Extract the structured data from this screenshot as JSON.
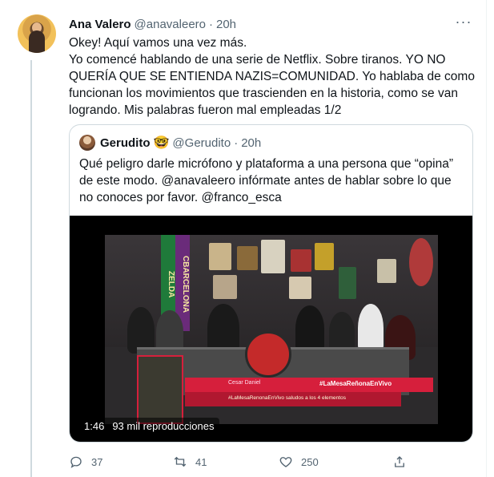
{
  "tweet": {
    "author_name": "Ana Valero",
    "handle": "@anavaleero",
    "separator": "·",
    "time": "20h",
    "text": "Okey! Aquí vamos una vez más.\nYo comencé hablando de una serie de Netflix. Sobre tiranos. YO NO QUERÍA QUE SE ENTIENDA NAZIS=COMUNIDAD. Yo hablaba de como funcionan los movimientos que trascienden en la historia, como se van logrando. Mis palabras fueron mal empleadas 1/2",
    "more_icon": "more-horizontal-icon"
  },
  "quote": {
    "author_name": "Gerudito",
    "emoji": "🤓",
    "handle": "@Gerudito",
    "separator": "·",
    "time": "20h",
    "text": "Qué peligro darle micrófono y plataforma a una persona que “opina” de este modo. @anavaleero infórmate antes de hablar sobre lo que no conoces por favor. @franco_esca",
    "video": {
      "duration": "1:46",
      "views": "93 mil reproducciones",
      "overlay": {
        "caller_name": "Cesar Daniel",
        "hashtag": "#LaMesaReñonaEnVivo",
        "message": "#LaMesaRenonaEnVivo saludos a los 4 elementos",
        "banner": "ZELDA",
        "banner2": "CBARCELONA"
      }
    }
  },
  "actions": {
    "reply": {
      "icon": "reply-icon",
      "count": "37"
    },
    "retweet": {
      "icon": "retweet-icon",
      "count": "41"
    },
    "like": {
      "icon": "heart-icon",
      "count": "250"
    },
    "share": {
      "icon": "share-icon"
    }
  },
  "colors": {
    "text": "#0f1419",
    "secondary": "#536471",
    "border": "#cfd9de",
    "overlay_red": "#d61f3c"
  }
}
